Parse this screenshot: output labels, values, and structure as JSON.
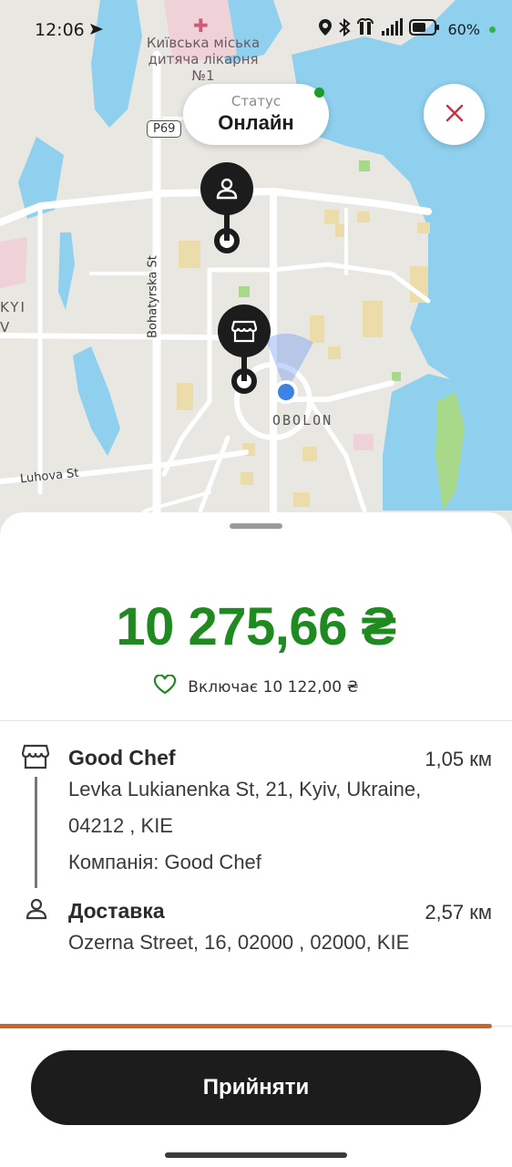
{
  "status_bar": {
    "time": "12:06",
    "battery_percent": "60%",
    "icons": [
      "send-icon",
      "location-icon",
      "bluetooth-icon",
      "hotspot-icon",
      "signal-icon",
      "battery-icon"
    ]
  },
  "map": {
    "labels": {
      "hospital": "Київська міська дитяча лікарня №1",
      "road_badge": "P69",
      "street_bohatyrska": "Bohatyrska St",
      "street_luhova": "Luhova St",
      "district": "OBOLON",
      "partial_left": "KYI\nV"
    },
    "colors": {
      "water": "#8fd0ee",
      "land": "#e9e7e2",
      "road": "#ffffff",
      "building": "#ecdcaa",
      "park": "#a8d88a",
      "hospital_area": "#efd2d8"
    }
  },
  "status": {
    "label": "Статус",
    "value": "Онлайн",
    "indicator_color": "#1a9b2a"
  },
  "order": {
    "amount": "10 275,66 ₴",
    "includes_text": "Включає 10 122,00 ₴",
    "amount_color": "#1f8a1f"
  },
  "route": {
    "pickup": {
      "name": "Good Chef",
      "distance": "1,05 км",
      "address_line1": "Levka Lukianenka St, 21, Kyiv, Ukraine,",
      "address_line2": "04212 , KIE",
      "company": "Компанія: Good Chef"
    },
    "dropoff": {
      "name": "Доставка",
      "distance": "2,57 км",
      "address": "Ozerna Street, 16, 02000 , 02000, KIE"
    }
  },
  "timer": {
    "remaining_fraction": 0.96,
    "color": "#c8652a"
  },
  "actions": {
    "accept_label": "Прийняти"
  }
}
